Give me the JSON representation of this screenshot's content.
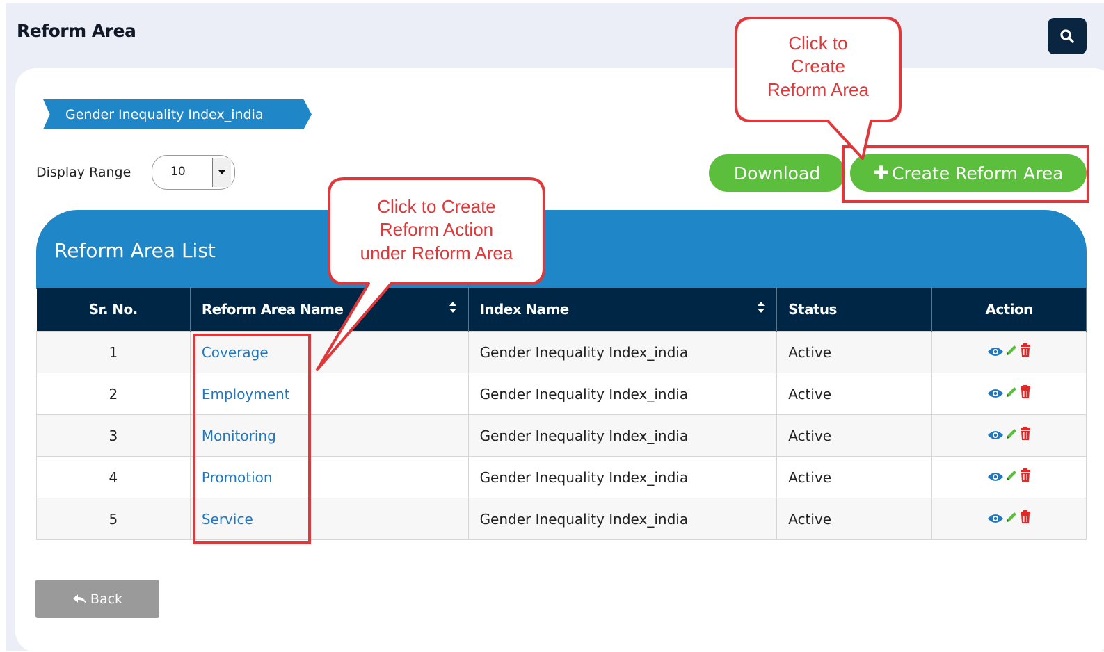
{
  "page": {
    "title": "Reform Area"
  },
  "breadcrumb": {
    "label": "Gender Inequality Index_india"
  },
  "display_range": {
    "label": "Display Range",
    "value": "10"
  },
  "toolbar": {
    "download_label": "Download",
    "create_plus": "✚",
    "create_label": "Create Reform Area"
  },
  "panel": {
    "title": "Reform Area List"
  },
  "table": {
    "headers": [
      "Sr. No.",
      "Reform Area Name",
      "Index Name",
      "Status",
      "Action"
    ],
    "rows": [
      {
        "sr": "1",
        "name": "Coverage",
        "index": "Gender Inequality Index_india",
        "status": "Active"
      },
      {
        "sr": "2",
        "name": "Employment",
        "index": "Gender Inequality Index_india",
        "status": "Active"
      },
      {
        "sr": "3",
        "name": "Monitoring",
        "index": "Gender Inequality Index_india",
        "status": "Active"
      },
      {
        "sr": "4",
        "name": "Promotion",
        "index": "Gender Inequality Index_india",
        "status": "Active"
      },
      {
        "sr": "5",
        "name": "Service",
        "index": "Gender Inequality Index_india",
        "status": "Active"
      }
    ],
    "actions": [
      "eye-icon",
      "pencil-icon",
      "trash-icon"
    ]
  },
  "back": {
    "label": "Back"
  },
  "callouts": {
    "create_area": [
      "Click to",
      "Create",
      "Reform Area"
    ],
    "create_action": [
      "Click to Create",
      "Reform Action",
      "under Reform Area"
    ]
  },
  "colors": {
    "navy": "#002645",
    "blue": "#1f86c8",
    "green": "#5bbe3c",
    "status_green": "#2f9a2a",
    "callout_red": "#e0383a",
    "link_blue": "#1f78c2"
  }
}
